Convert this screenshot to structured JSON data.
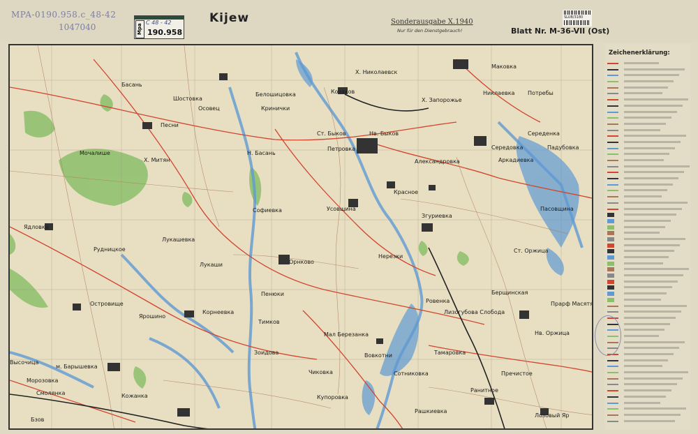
{
  "header": {
    "title": "Kijew",
    "edition": "Sonderausgabe X.1940",
    "edition_note": "Nur für den Dienstgebrauch!",
    "sheet_number": "Blatt Nr. M-36-VII (Ost)"
  },
  "archive": {
    "code": "MPA-0190.958.c_48-42",
    "code2": "1047040",
    "stamp_label": "Mpa",
    "stamp_number": "190.958",
    "stamp_handwritten": "C 48 - 42",
    "barcode_text": "SLUB/3180"
  },
  "legend": {
    "title": "Zeichenerklärung:",
    "colors": {
      "road_main": "#d2452f",
      "water": "#5f9ad3",
      "forest": "#8cbf6a",
      "settlement": "#333333"
    }
  },
  "places": [
    {
      "name": "Шостовка",
      "x": "Шостовка"
    },
    {
      "name": "Басань"
    },
    {
      "name": "Осовец"
    },
    {
      "name": "Белошицовка"
    },
    {
      "name": "Козаков"
    },
    {
      "name": "Х. Николаевск"
    },
    {
      "name": "Маковка"
    },
    {
      "name": "Потребы"
    },
    {
      "name": "Никлаевка"
    },
    {
      "name": "Песни"
    },
    {
      "name": "Кринички"
    },
    {
      "name": "Ст. Быков"
    },
    {
      "name": "Нв. Быков"
    },
    {
      "name": "Х. Запорожье"
    },
    {
      "name": "Середенка"
    },
    {
      "name": "Середовка"
    },
    {
      "name": "Падубовка"
    },
    {
      "name": "Мочалише"
    },
    {
      "name": "Х. Митян"
    },
    {
      "name": "Н. Басань"
    },
    {
      "name": "Петровка"
    },
    {
      "name": "Александровка"
    },
    {
      "name": "Аркадиевка"
    },
    {
      "name": "Красное"
    },
    {
      "name": "Ядловка"
    },
    {
      "name": "Софиевка"
    },
    {
      "name": "Усовщина"
    },
    {
      "name": "Згуриевка"
    },
    {
      "name": "Пасовщина"
    },
    {
      "name": "Лукашевка"
    },
    {
      "name": "Рудницкое"
    },
    {
      "name": "Лукаши"
    },
    {
      "name": "Орнково"
    },
    {
      "name": "Нерезки"
    },
    {
      "name": "Ст. Оржица"
    },
    {
      "name": "Островище"
    },
    {
      "name": "Пенюки"
    },
    {
      "name": "Корнеевка"
    },
    {
      "name": "Лизогубова Слобода"
    },
    {
      "name": "Ровенка"
    },
    {
      "name": "Прарф Масятя"
    },
    {
      "name": "Берщинская"
    },
    {
      "name": "Ярошино"
    },
    {
      "name": "Тимков"
    },
    {
      "name": "Мал Березанка"
    },
    {
      "name": "Нв. Оржица"
    },
    {
      "name": "Вовкотни"
    },
    {
      "name": "Тамаровка"
    },
    {
      "name": "Высочица"
    },
    {
      "name": "м. Барышевка"
    },
    {
      "name": "Зоидова"
    },
    {
      "name": "Чиковка"
    },
    {
      "name": "Сотниковка"
    },
    {
      "name": "Пречистое"
    },
    {
      "name": "Морозовка"
    },
    {
      "name": "Смолянка"
    },
    {
      "name": "Кожанка"
    },
    {
      "name": "Купоровка"
    },
    {
      "name": "Ранитное"
    },
    {
      "name": "Рашкиевка"
    },
    {
      "name": "Лозовый Яр"
    },
    {
      "name": "Бзов"
    }
  ]
}
